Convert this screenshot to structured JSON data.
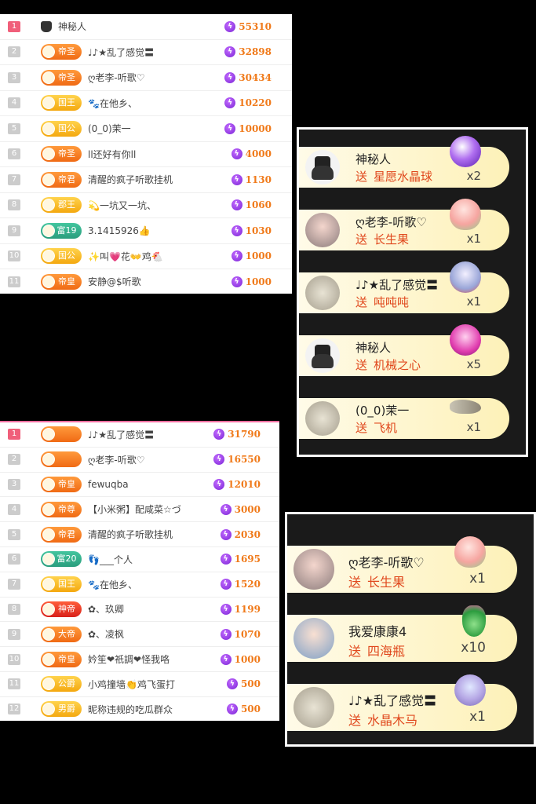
{
  "ranking_top": [
    {
      "rank": "1",
      "title": "",
      "name": "神秘人",
      "score": "55310",
      "badge": "none"
    },
    {
      "rank": "2",
      "title": "帝圣",
      "name": "♩♪★乱了感觉〓",
      "score": "32898",
      "badge": "orange"
    },
    {
      "rank": "3",
      "title": "帝圣",
      "name": "ღ老李-听歌♡",
      "score": "30434",
      "badge": "orange"
    },
    {
      "rank": "4",
      "title": "国王",
      "name": "🐾在他乡、",
      "score": "10220",
      "badge": "gold"
    },
    {
      "rank": "5",
      "title": "国公",
      "name": "(0_0)茉一",
      "score": "10000",
      "badge": "gold"
    },
    {
      "rank": "6",
      "title": "帝圣",
      "name": "ll还好有你ll",
      "score": "4000",
      "badge": "orange"
    },
    {
      "rank": "7",
      "title": "帝君",
      "name": "清醒的疯子听歌挂机",
      "score": "1130",
      "badge": "orange"
    },
    {
      "rank": "8",
      "title": "郡王",
      "name": "💫一坑又一坑、",
      "score": "1060",
      "badge": "gold"
    },
    {
      "rank": "9",
      "title": "富19",
      "name": "3.1415926👍",
      "score": "1030",
      "badge": "teal"
    },
    {
      "rank": "10",
      "title": "国公",
      "name": "✨叫💗花👐鸡🐔",
      "score": "1000",
      "badge": "gold"
    },
    {
      "rank": "11",
      "title": "帝皇",
      "name": "安静@$听歌",
      "score": "1000",
      "badge": "orange"
    }
  ],
  "ranking_bottom": [
    {
      "rank": "1",
      "title": "",
      "name": "♩♪★乱了感觉〓",
      "score": "31790",
      "badge": "orange"
    },
    {
      "rank": "2",
      "title": "",
      "name": "ღ老李-听歌♡",
      "score": "16550",
      "badge": "orange"
    },
    {
      "rank": "3",
      "title": "帝皇",
      "name": "fewuqba",
      "score": "12010",
      "badge": "orange"
    },
    {
      "rank": "4",
      "title": "帝尊",
      "name": "【小米粥】配咸菜☆づ",
      "score": "3000",
      "badge": "orange"
    },
    {
      "rank": "5",
      "title": "帝君",
      "name": "清醒的疯子听歌挂机",
      "score": "2030",
      "badge": "orange"
    },
    {
      "rank": "6",
      "title": "富20",
      "name": "👣___个人",
      "score": "1695",
      "badge": "teal"
    },
    {
      "rank": "7",
      "title": "国王",
      "name": "🐾在他乡、",
      "score": "1520",
      "badge": "gold"
    },
    {
      "rank": "8",
      "title": "神帝",
      "name": "✿、玖卿",
      "score": "1199",
      "badge": "red"
    },
    {
      "rank": "9",
      "title": "大帝",
      "name": "✿、凌枫",
      "score": "1070",
      "badge": "orange"
    },
    {
      "rank": "10",
      "title": "帝皇",
      "name": "妗笙❤祇調❤怪我咯",
      "score": "1000",
      "badge": "orange"
    },
    {
      "rank": "11",
      "title": "公爵",
      "name": "小鸡撞墙👏鸡飞蛋打",
      "score": "500",
      "badge": "gold"
    },
    {
      "rank": "12",
      "title": "男爵",
      "name": "昵称违规的吃瓜群众",
      "score": "500",
      "badge": "gold"
    }
  ],
  "gift_feed_top": [
    {
      "sender": "神秘人",
      "verb": "送",
      "gift": "星愿水晶球",
      "qty": "x2",
      "avatar": "hat",
      "icon": "purple"
    },
    {
      "sender": "ღ老李-听歌♡",
      "verb": "送",
      "gift": "长生果",
      "qty": "x1",
      "avatar": "photo",
      "icon": "peach"
    },
    {
      "sender": "♩♪★乱了感觉〓",
      "verb": "送",
      "gift": "吨吨吨",
      "qty": "x1",
      "avatar": "sketch",
      "icon": "pig"
    },
    {
      "sender": "神秘人",
      "verb": "送",
      "gift": "机械之心",
      "qty": "x5",
      "avatar": "hat",
      "icon": "heart"
    },
    {
      "sender": "(0_0)茉一",
      "verb": "送",
      "gift": "飞机",
      "qty": "x1",
      "avatar": "sketch",
      "icon": "plane"
    }
  ],
  "gift_feed_bottom": [
    {
      "sender": "ღ老李-听歌♡",
      "verb": "送",
      "gift": "长生果",
      "qty": "x1",
      "avatar": "photo",
      "icon": "peach"
    },
    {
      "sender": "我爱康康4",
      "verb": "送",
      "gift": "四海瓶",
      "qty": "x10",
      "avatar": "girl",
      "icon": "vase"
    },
    {
      "sender": "♩♪★乱了感觉〓",
      "verb": "送",
      "gift": "水晶木马",
      "qty": "x1",
      "avatar": "sketch",
      "icon": "carousel"
    }
  ],
  "bolt_glyph": "ϟ"
}
